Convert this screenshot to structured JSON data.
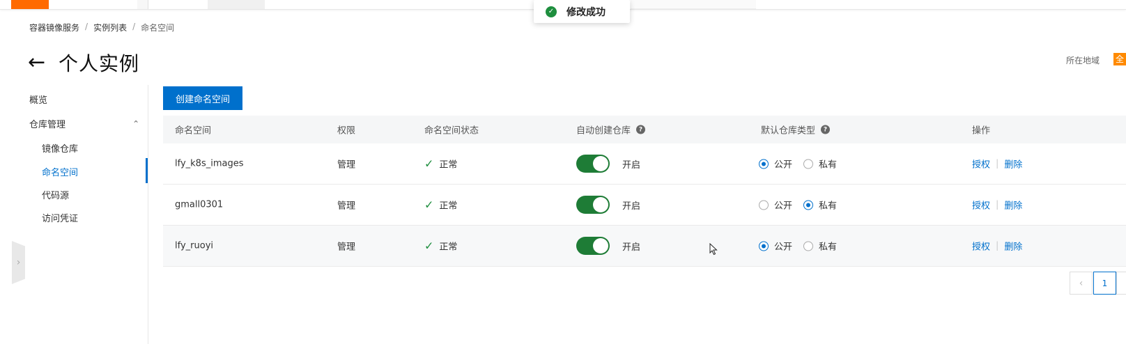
{
  "toast": {
    "message": "修改成功"
  },
  "breadcrumb": [
    "容器镜像服务",
    "实例列表",
    "命名空间"
  ],
  "page": {
    "title": "个人实例",
    "back_icon": "arrow-left-icon"
  },
  "region": {
    "label": "所在地域",
    "badge": "全"
  },
  "sidebar": {
    "items": [
      {
        "label": "概览"
      },
      {
        "label": "仓库管理"
      },
      {
        "label": "镜像仓库"
      },
      {
        "label": "命名空间",
        "active": true
      },
      {
        "label": "代码源"
      },
      {
        "label": "访问凭证"
      }
    ]
  },
  "toolbar": {
    "create_label": "创建命名空间"
  },
  "table": {
    "headers": [
      "命名空间",
      "权限",
      "命名空间状态",
      "自动创建仓库",
      "默认仓库类型",
      "操作"
    ],
    "rows": [
      {
        "name": "lfy_k8s_images",
        "permission": "管理",
        "status": "正常",
        "auto_create": "开启",
        "auto_create_on": true,
        "default_type": "公开"
      },
      {
        "name": "gmall0301",
        "permission": "管理",
        "status": "正常",
        "auto_create": "开启",
        "auto_create_on": true,
        "default_type": "私有"
      },
      {
        "name": "lfy_ruoyi",
        "permission": "管理",
        "status": "正常",
        "auto_create": "开启",
        "auto_create_on": true,
        "default_type": "公开"
      }
    ],
    "radio_options": [
      "公开",
      "私有"
    ],
    "actions": [
      "授权",
      "删除"
    ]
  },
  "pagination": {
    "current": "1"
  },
  "colors": {
    "primary": "#0070cc",
    "success": "#1e8e3e",
    "brand": "#ff6a00"
  }
}
